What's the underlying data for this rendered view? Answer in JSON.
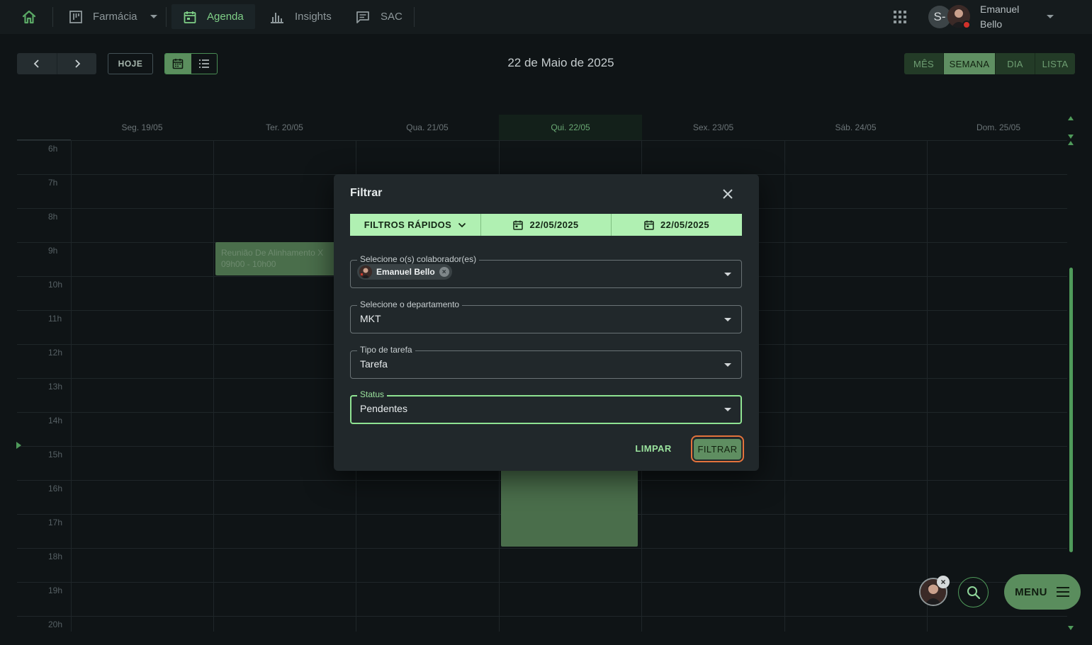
{
  "topbar": {
    "home_icon": "home-icon",
    "nav": [
      {
        "label": "Farmácia",
        "icon": "kanban-icon"
      },
      {
        "label": "Agenda",
        "icon": "calendar-icon"
      },
      {
        "label": "Insights",
        "icon": "bar-chart-icon"
      },
      {
        "label": "SAC",
        "icon": "chat-icon"
      }
    ],
    "avatar_initial": "S-",
    "user_first": "Emanuel",
    "user_last": "Bello"
  },
  "toolbar": {
    "today_label": "HOJE",
    "date_title": "22 de Maio de 2025",
    "ranges": [
      "MÊS",
      "SEMANA",
      "DIA",
      "LISTA"
    ],
    "selected_range": "SEMANA"
  },
  "calendar": {
    "days": [
      "Seg. 19/05",
      "Ter. 20/05",
      "Qua. 21/05",
      "Qui. 22/05",
      "Sex. 23/05",
      "Sáb. 24/05",
      "Dom. 25/05"
    ],
    "today": "Qui. 22/05",
    "hours": [
      "6h",
      "7h",
      "8h",
      "9h",
      "10h",
      "11h",
      "12h",
      "13h",
      "14h",
      "15h",
      "16h",
      "17h",
      "18h",
      "19h",
      "20h"
    ],
    "events": [
      {
        "title": "Reunião De Alinhamento X",
        "time": "09h00 - 10h00"
      }
    ],
    "accent": "#4f9a5a"
  },
  "modal": {
    "title": "Filtrar",
    "quick_filters_label": "FILTROS RÁPIDOS",
    "date_from": "22/05/2025",
    "date_to": "22/05/2025",
    "collaborators_label": "Selecione o(s) colaborador(es)",
    "collaborator_chip": "Emanuel Bello",
    "department_label": "Selecione o departamento",
    "department_value": "MKT",
    "task_type_label": "Tipo de tarefa",
    "task_type_value": "Tarefa",
    "status_label": "Status",
    "status_value": "Pendentes",
    "clear_label": "LIMPAR",
    "filter_label": "FILTRAR"
  },
  "fab": {
    "menu_label": "MENU"
  }
}
